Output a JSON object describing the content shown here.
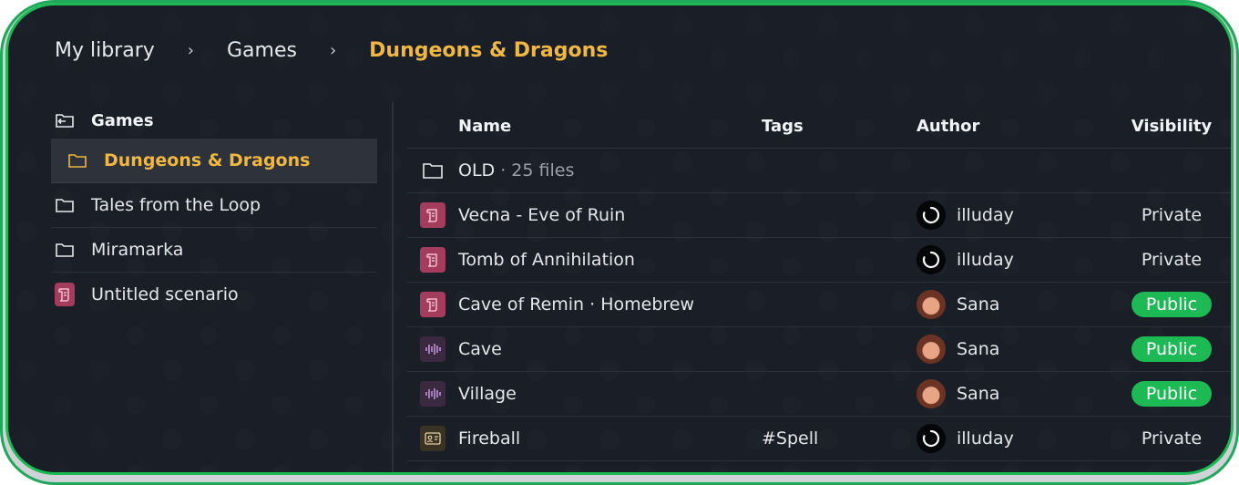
{
  "breadcrumb": {
    "items": [
      "My library",
      "Games",
      "Dungeons & Dragons"
    ],
    "separator": "›"
  },
  "sidebar": {
    "root": "Games",
    "items": [
      {
        "label": "Dungeons & Dragons",
        "icon": "folder-icon",
        "active": true
      },
      {
        "label": "Tales from the Loop",
        "icon": "folder-icon"
      },
      {
        "label": "Miramarka",
        "icon": "folder-icon"
      },
      {
        "label": "Untitled scenario",
        "icon": "scenario-icon"
      }
    ]
  },
  "table": {
    "headers": {
      "name": "Name",
      "tags": "Tags",
      "author": "Author",
      "visibility": "Visibility"
    },
    "folder_row": {
      "name": "OLD",
      "meta": " · 25 files"
    },
    "rows": [
      {
        "name": "Vecna - Eve of Ruin",
        "type": "scenario",
        "tags": "",
        "author": "illuday",
        "avatar": "dark",
        "visibility": "Private"
      },
      {
        "name": "Tomb of Annihilation",
        "type": "scenario",
        "tags": "",
        "author": "illuday",
        "avatar": "dark",
        "visibility": "Private"
      },
      {
        "name": "Cave of Remin · Homebrew",
        "type": "scenario",
        "tags": "",
        "author": "Sana",
        "avatar": "girl",
        "visibility": "Public"
      },
      {
        "name": "Cave",
        "type": "audio",
        "tags": "",
        "author": "Sana",
        "avatar": "girl",
        "visibility": "Public"
      },
      {
        "name": "Village",
        "type": "audio",
        "tags": "",
        "author": "Sana",
        "avatar": "girl",
        "visibility": "Public"
      },
      {
        "name": "Fireball",
        "type": "card",
        "tags": "#Spell",
        "author": "illuday",
        "avatar": "dark",
        "visibility": "Private"
      }
    ]
  },
  "colors": {
    "accent": "#f0b742",
    "public": "#1db954",
    "scenario": "#a43c5d",
    "background": "#1a1e26"
  }
}
